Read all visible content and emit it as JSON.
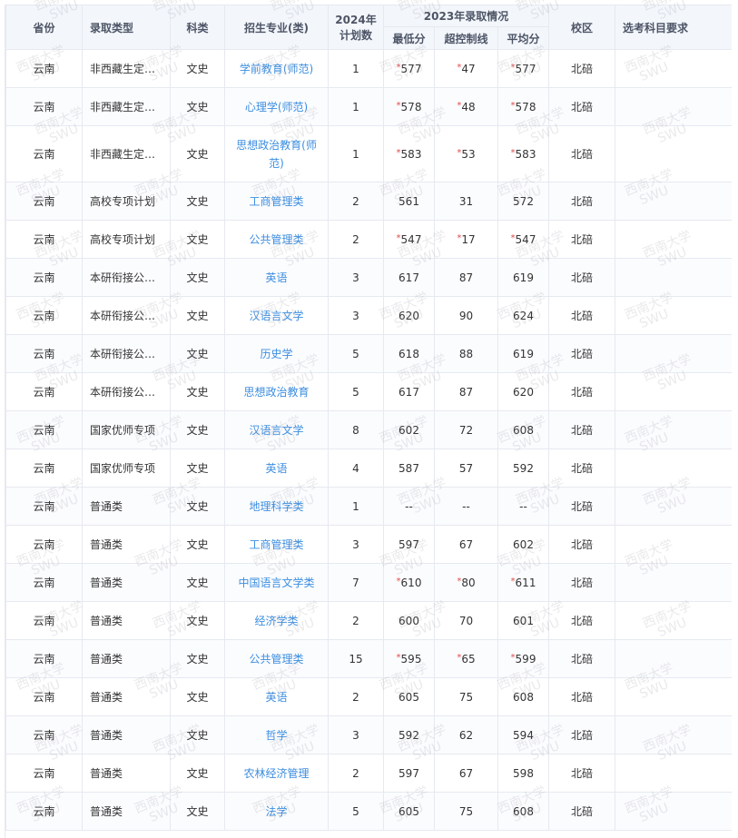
{
  "headers": {
    "province": "省份",
    "admission_type": "录取类型",
    "subject": "科类",
    "major": "招生专业(类)",
    "plan_2024_line1": "2024年",
    "plan_2024_line2": "计划数",
    "admission_2023": "2023年录取情况",
    "min_score": "最低分",
    "over_control": "超控制线",
    "avg_score": "平均分",
    "campus": "校区",
    "subject_req": "选考科目要求"
  },
  "watermark": {
    "line1": "西南大学",
    "line2": "SWU"
  },
  "rows": [
    {
      "province": "云南",
      "type": "非西藏生定…",
      "subject": "文史",
      "major": "学前教育(师范)",
      "plan": "1",
      "min_star": "*",
      "min": "577",
      "over_star": "*",
      "over": "47",
      "avg_star": "*",
      "avg": "577",
      "campus": "北碚",
      "req": ""
    },
    {
      "province": "云南",
      "type": "非西藏生定…",
      "subject": "文史",
      "major": "心理学(师范)",
      "plan": "1",
      "min_star": "*",
      "min": "578",
      "over_star": "*",
      "over": "48",
      "avg_star": "*",
      "avg": "578",
      "campus": "北碚",
      "req": ""
    },
    {
      "province": "云南",
      "type": "非西藏生定…",
      "subject": "文史",
      "major": "思想政治教育(师范)",
      "plan": "1",
      "min_star": "*",
      "min": "583",
      "over_star": "*",
      "over": "53",
      "avg_star": "*",
      "avg": "583",
      "campus": "北碚",
      "req": ""
    },
    {
      "province": "云南",
      "type": "高校专项计划",
      "subject": "文史",
      "major": "工商管理类",
      "plan": "2",
      "min_star": "",
      "min": "561",
      "over_star": "",
      "over": "31",
      "avg_star": "",
      "avg": "572",
      "campus": "北碚",
      "req": ""
    },
    {
      "province": "云南",
      "type": "高校专项计划",
      "subject": "文史",
      "major": "公共管理类",
      "plan": "2",
      "min_star": "*",
      "min": "547",
      "over_star": "*",
      "over": "17",
      "avg_star": "*",
      "avg": "547",
      "campus": "北碚",
      "req": ""
    },
    {
      "province": "云南",
      "type": "本研衔接公…",
      "subject": "文史",
      "major": "英语",
      "plan": "3",
      "min_star": "",
      "min": "617",
      "over_star": "",
      "over": "87",
      "avg_star": "",
      "avg": "619",
      "campus": "北碚",
      "req": ""
    },
    {
      "province": "云南",
      "type": "本研衔接公…",
      "subject": "文史",
      "major": "汉语言文学",
      "plan": "3",
      "min_star": "",
      "min": "620",
      "over_star": "",
      "over": "90",
      "avg_star": "",
      "avg": "624",
      "campus": "北碚",
      "req": ""
    },
    {
      "province": "云南",
      "type": "本研衔接公…",
      "subject": "文史",
      "major": "历史学",
      "plan": "5",
      "min_star": "",
      "min": "618",
      "over_star": "",
      "over": "88",
      "avg_star": "",
      "avg": "619",
      "campus": "北碚",
      "req": ""
    },
    {
      "province": "云南",
      "type": "本研衔接公…",
      "subject": "文史",
      "major": "思想政治教育",
      "plan": "5",
      "min_star": "",
      "min": "617",
      "over_star": "",
      "over": "87",
      "avg_star": "",
      "avg": "620",
      "campus": "北碚",
      "req": ""
    },
    {
      "province": "云南",
      "type": "国家优师专项",
      "subject": "文史",
      "major": "汉语言文学",
      "plan": "8",
      "min_star": "",
      "min": "602",
      "over_star": "",
      "over": "72",
      "avg_star": "",
      "avg": "608",
      "campus": "北碚",
      "req": ""
    },
    {
      "province": "云南",
      "type": "国家优师专项",
      "subject": "文史",
      "major": "英语",
      "plan": "4",
      "min_star": "",
      "min": "587",
      "over_star": "",
      "over": "57",
      "avg_star": "",
      "avg": "592",
      "campus": "北碚",
      "req": ""
    },
    {
      "province": "云南",
      "type": "普通类",
      "subject": "文史",
      "major": "地理科学类",
      "plan": "1",
      "min_star": "",
      "min": "--",
      "over_star": "",
      "over": "--",
      "avg_star": "",
      "avg": "--",
      "campus": "北碚",
      "req": ""
    },
    {
      "province": "云南",
      "type": "普通类",
      "subject": "文史",
      "major": "工商管理类",
      "plan": "3",
      "min_star": "",
      "min": "597",
      "over_star": "",
      "over": "67",
      "avg_star": "",
      "avg": "602",
      "campus": "北碚",
      "req": ""
    },
    {
      "province": "云南",
      "type": "普通类",
      "subject": "文史",
      "major": "中国语言文学类",
      "plan": "7",
      "min_star": "*",
      "min": "610",
      "over_star": "*",
      "over": "80",
      "avg_star": "*",
      "avg": "611",
      "campus": "北碚",
      "req": ""
    },
    {
      "province": "云南",
      "type": "普通类",
      "subject": "文史",
      "major": "经济学类",
      "plan": "2",
      "min_star": "",
      "min": "600",
      "over_star": "",
      "over": "70",
      "avg_star": "",
      "avg": "601",
      "campus": "北碚",
      "req": ""
    },
    {
      "province": "云南",
      "type": "普通类",
      "subject": "文史",
      "major": "公共管理类",
      "plan": "15",
      "min_star": "*",
      "min": "595",
      "over_star": "*",
      "over": "65",
      "avg_star": "*",
      "avg": "599",
      "campus": "北碚",
      "req": ""
    },
    {
      "province": "云南",
      "type": "普通类",
      "subject": "文史",
      "major": "英语",
      "plan": "2",
      "min_star": "",
      "min": "605",
      "over_star": "",
      "over": "75",
      "avg_star": "",
      "avg": "608",
      "campus": "北碚",
      "req": ""
    },
    {
      "province": "云南",
      "type": "普通类",
      "subject": "文史",
      "major": "哲学",
      "plan": "3",
      "min_star": "",
      "min": "592",
      "over_star": "",
      "over": "62",
      "avg_star": "",
      "avg": "594",
      "campus": "北碚",
      "req": ""
    },
    {
      "province": "云南",
      "type": "普通类",
      "subject": "文史",
      "major": "农林经济管理",
      "plan": "2",
      "min_star": "",
      "min": "597",
      "over_star": "",
      "over": "67",
      "avg_star": "",
      "avg": "598",
      "campus": "北碚",
      "req": ""
    },
    {
      "province": "云南",
      "type": "普通类",
      "subject": "文史",
      "major": "法学",
      "plan": "5",
      "min_star": "",
      "min": "605",
      "over_star": "",
      "over": "75",
      "avg_star": "",
      "avg": "608",
      "campus": "北碚",
      "req": ""
    }
  ]
}
